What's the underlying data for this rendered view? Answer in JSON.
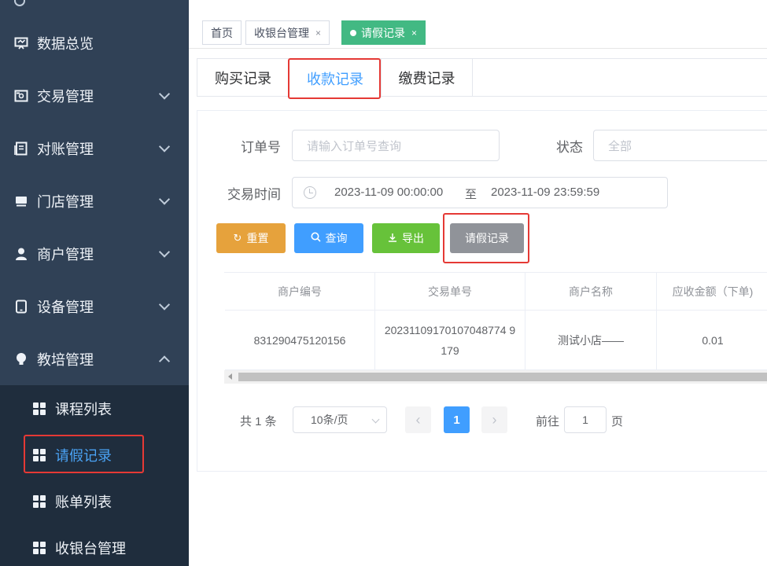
{
  "sidebar": {
    "items": [
      {
        "label": "数据总览",
        "icon": "monitor-icon"
      },
      {
        "label": "交易管理",
        "icon": "wallet-icon"
      },
      {
        "label": "对账管理",
        "icon": "document-icon"
      },
      {
        "label": "门店管理",
        "icon": "store-icon"
      },
      {
        "label": "商户管理",
        "icon": "user-icon"
      },
      {
        "label": "设备管理",
        "icon": "tablet-icon"
      },
      {
        "label": "教培管理",
        "icon": "lightbulb-icon"
      }
    ],
    "sub_items": [
      {
        "label": "课程列表"
      },
      {
        "label": "请假记录"
      },
      {
        "label": "账单列表"
      },
      {
        "label": "收银台管理"
      }
    ]
  },
  "tagbar": {
    "tags": [
      {
        "label": "首页"
      },
      {
        "label": "收银台管理",
        "close": "×"
      },
      {
        "label": "请假记录",
        "close": "×"
      }
    ]
  },
  "tabs": [
    {
      "label": "购买记录"
    },
    {
      "label": "收款记录"
    },
    {
      "label": "缴费记录"
    }
  ],
  "filters": {
    "order_label": "订单号",
    "order_placeholder": "请输入订单号查询",
    "status_label": "状态",
    "status_value": "全部",
    "time_label": "交易时间",
    "time_start": "2023-11-09 00:00:00",
    "time_sep": "至",
    "time_end": "2023-11-09 23:59:59"
  },
  "buttons": {
    "reset": "重置",
    "query": "查询",
    "export": "导出",
    "leave": "请假记录"
  },
  "table": {
    "headers": [
      "商户编号",
      "交易单号",
      "商户名称",
      "应收金额（下单)"
    ],
    "rows": [
      {
        "merchant_no": "831290475120156",
        "trade_no": "20231109170107048774 9179",
        "merchant_name": "测试小店——",
        "amount": "0.01"
      }
    ]
  },
  "pagination": {
    "total": "共 1 条",
    "page_size": "10条/页",
    "prev": "‹",
    "current": "1",
    "next": "›",
    "goto_label": "前往",
    "goto_value": "1",
    "page_unit": "页"
  },
  "colors": {
    "sidebar_bg": "#304156",
    "submenu_bg": "#1f2d3d",
    "primary": "#409eff",
    "tag_active": "#42b983",
    "reset": "#e6a23c",
    "export": "#67c23a",
    "leave": "#909399",
    "highlight": "#e53935"
  }
}
